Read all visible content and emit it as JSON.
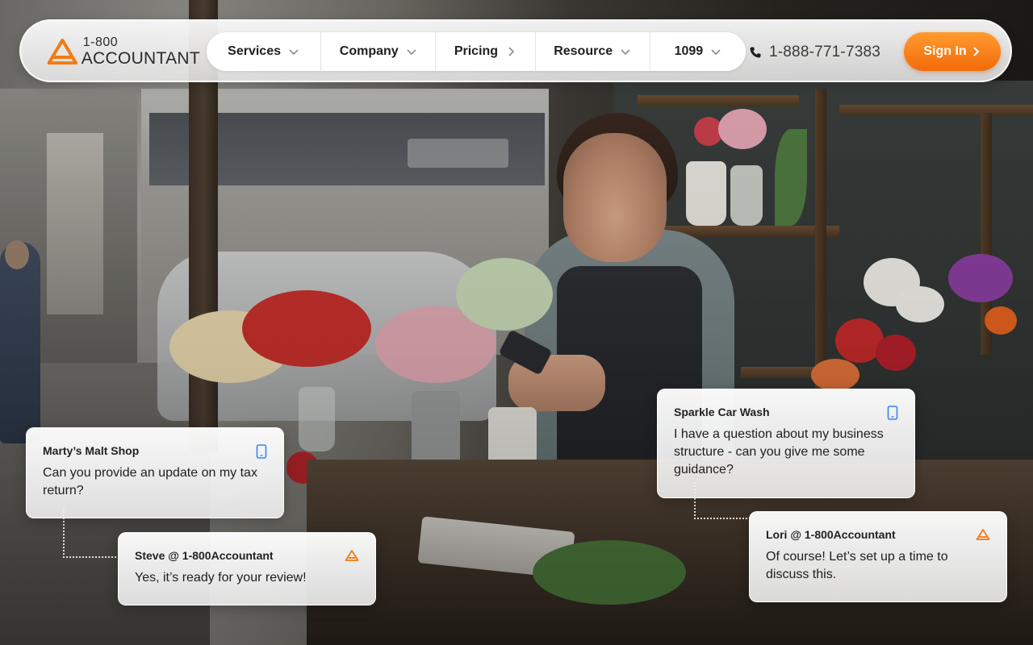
{
  "brand": {
    "logo_top": "1-800",
    "logo_bottom": "ACCOUNTANT",
    "accent": "#f47a12"
  },
  "nav": {
    "items": [
      {
        "label": "Services",
        "icon": "chevron-down-icon"
      },
      {
        "label": "Company",
        "icon": "chevron-down-icon"
      },
      {
        "label": "Pricing",
        "icon": "chevron-right-icon"
      },
      {
        "label": "Resource",
        "icon": "chevron-down-icon"
      },
      {
        "label": "1099",
        "icon": "chevron-down-icon"
      }
    ],
    "phone": "1-888-771-7383",
    "phone_icon": "phone-icon",
    "signin_label": "Sign In",
    "signin_icon": "chevron-right-icon"
  },
  "chats": [
    {
      "name": "Marty’s Malt Shop",
      "message": "Can you provide an update on my tax return?",
      "icon": "mobile-phone-icon"
    },
    {
      "name": "Steve @ 1-800Accountant",
      "message": "Yes, it’s ready for your review!",
      "icon": "brand-logo-icon"
    },
    {
      "name": "Sparkle Car Wash",
      "message": "I have a question about my business structure - can you give me some guidance?",
      "icon": "mobile-phone-icon"
    },
    {
      "name": "Lori @ 1-800Accountant",
      "message": "Of course! Let’s set up a time to discuss this.",
      "icon": "brand-logo-icon"
    }
  ],
  "colors": {
    "signin_gradient_start": "#ff9a2e",
    "signin_gradient_end": "#f26b0a",
    "customer_icon": "#3b82f6",
    "agent_icon": "#f47a12"
  }
}
